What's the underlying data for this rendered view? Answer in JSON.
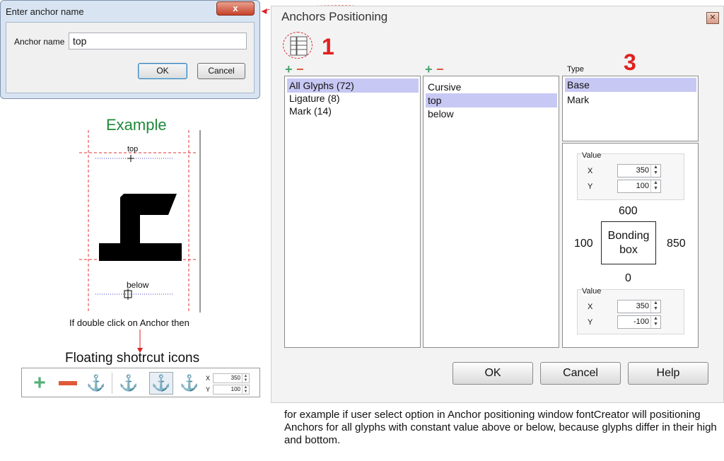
{
  "anchor_dialog": {
    "title": "Enter anchor name",
    "close_label": "x",
    "field_label": "Anchor name",
    "field_value": "top",
    "ok_label": "OK",
    "cancel_label": "Cancel"
  },
  "example": {
    "title": "Example",
    "top_label": "top",
    "below_label": "below",
    "hint": "If double click on Anchor then",
    "floating_title": "Floating shotrcut icons",
    "toolbar": {
      "icons": [
        "plus-icon",
        "minus-icon",
        "anchor-edit-icon",
        "anchor-list-icon",
        "anchor-icon",
        "anchor-lock-icon"
      ],
      "x_label": "X",
      "x_value": "350",
      "y_label": "Y",
      "y_value": "100"
    }
  },
  "window": {
    "title": "Anchors Positioning",
    "marker_1": "1",
    "marker_3": "3",
    "plus": "+",
    "minus": "−",
    "glyph_list": [
      "All Glyphs (72)",
      "Ligature (8)",
      "Mark (14)"
    ],
    "anchor_list": [
      "Cursive",
      "top",
      "below"
    ],
    "type_label": "Type",
    "type_list": [
      "Base",
      "Mark"
    ],
    "value_top": {
      "title": "Value",
      "x_label": "X",
      "x_value": "350",
      "y_label": "Y",
      "y_value": "100"
    },
    "value_bottom": {
      "title": "Value",
      "x_label": "X",
      "x_value": "350",
      "y_label": "Y",
      "y_value": "-100"
    },
    "bbox": {
      "line1": "Bonding",
      "line2": "box",
      "top": "600",
      "left": "100",
      "right": "850",
      "bottom": "0"
    },
    "ok_label": "OK",
    "cancel_label": "Cancel",
    "help_label": "Help"
  },
  "caption": "for example if user select option in  Anchor positioning window fontCreator will positioning Anchors for all glyphs with constant value above or below, because glyphs differ in their high and bottom.",
  "colors": {
    "accent_red": "#e02020",
    "example_green": "#1f8a3a",
    "selection": "#c8c8f4"
  }
}
